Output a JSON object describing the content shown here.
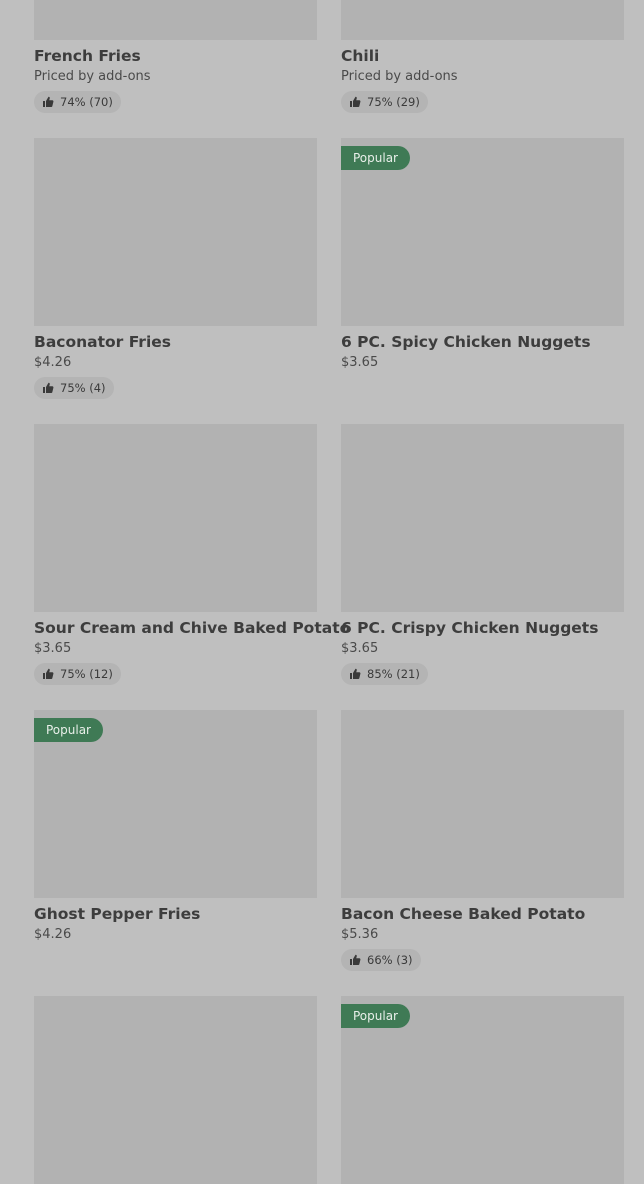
{
  "menu": {
    "items": [
      {
        "name": "French Fries",
        "price": "Priced by add-ons",
        "badge": "",
        "rating": "74% (70)"
      },
      {
        "name": "Chili",
        "price": "Priced by add-ons",
        "badge": "",
        "rating": "75% (29)"
      },
      {
        "name": "Baconator Fries",
        "price": "$4.26",
        "badge": "",
        "rating": "75% (4)"
      },
      {
        "name": "6 PC. Spicy Chicken Nuggets",
        "price": "$3.65",
        "badge": "Popular",
        "rating": ""
      },
      {
        "name": "Sour Cream and Chive Baked Potato",
        "price": "$3.65",
        "badge": "",
        "rating": "75% (12)"
      },
      {
        "name": "6 PC. Crispy Chicken Nuggets",
        "price": "$3.65",
        "badge": "",
        "rating": "85% (21)"
      },
      {
        "name": "Ghost Pepper Fries",
        "price": "$4.26",
        "badge": "Popular",
        "rating": ""
      },
      {
        "name": "Bacon Cheese Baked Potato",
        "price": "$5.36",
        "badge": "",
        "rating": "66% (3)"
      },
      {
        "name": "",
        "price": "",
        "badge": "",
        "rating": ""
      },
      {
        "name": "",
        "price": "",
        "badge": "Popular",
        "rating": ""
      }
    ]
  },
  "colors": {
    "background": "#bfbfbf",
    "thumbnail": "#b2b2b2",
    "badge": "#3f7a55",
    "rating_pill": "#b4b4b4"
  },
  "icons": {
    "rating": "thumbs-up-icon"
  }
}
